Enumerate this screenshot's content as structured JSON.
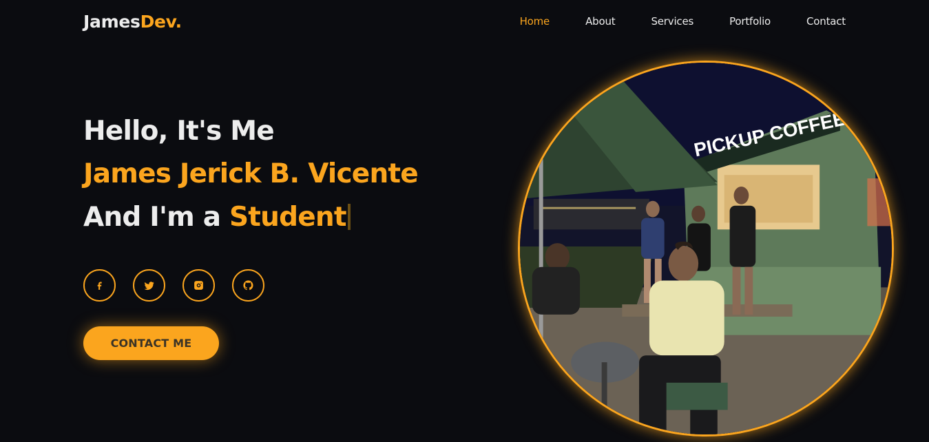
{
  "header": {
    "logo_main": "James",
    "logo_accent": "Dev.",
    "nav": [
      {
        "label": "Home",
        "active": true
      },
      {
        "label": "About"
      },
      {
        "label": "Services"
      },
      {
        "label": "Portfolio"
      },
      {
        "label": "Contact"
      }
    ]
  },
  "hero": {
    "greeting": "Hello, It's Me",
    "name": "James Jerick B. Vicente",
    "role_prefix": "And I'm a ",
    "role": "Student"
  },
  "socials": [
    {
      "icon": "facebook-icon"
    },
    {
      "icon": "twitter-icon"
    },
    {
      "icon": "instagram-icon"
    },
    {
      "icon": "github-icon"
    }
  ],
  "cta": {
    "label": "CONTACT ME"
  },
  "photo": {
    "sign_text": "PICKUP COFFEE"
  },
  "colors": {
    "accent": "#fba51e",
    "background": "#0b0c10",
    "text": "#ededed"
  }
}
